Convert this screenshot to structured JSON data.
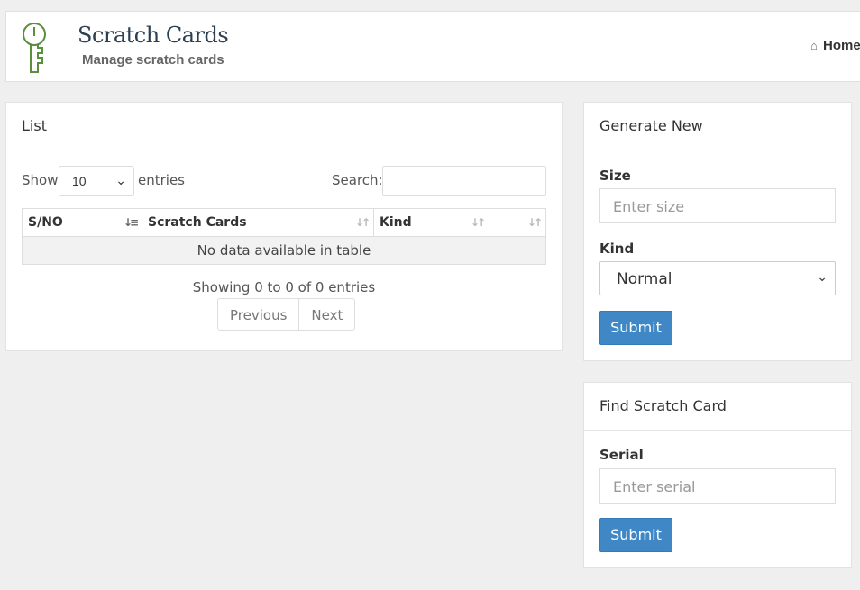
{
  "header": {
    "title": "Scratch Cards",
    "subtitle": "Manage scratch cards",
    "breadcrumb": "Home",
    "logo_icon": "key-icon",
    "logo_color": "#5a8f3c"
  },
  "list": {
    "title": "List",
    "show_label": "Show",
    "page_length": "10",
    "entries_label": "entries",
    "search_label": "Search:",
    "columns": [
      "S/NO",
      "Scratch Cards",
      "Kind",
      ""
    ],
    "empty_text": "No data available in table",
    "info": "Showing 0 to 0 of 0 entries",
    "prev": "Previous",
    "next": "Next"
  },
  "generate": {
    "title": "Generate New",
    "size_label": "Size",
    "size_placeholder": "Enter size",
    "kind_label": "Kind",
    "kind_value": "Normal",
    "submit": "Submit"
  },
  "find": {
    "title": "Find Scratch Card",
    "serial_label": "Serial",
    "serial_placeholder": "Enter serial",
    "submit": "Submit"
  },
  "colors": {
    "accent": "#3f88c5",
    "background": "#efefef"
  }
}
